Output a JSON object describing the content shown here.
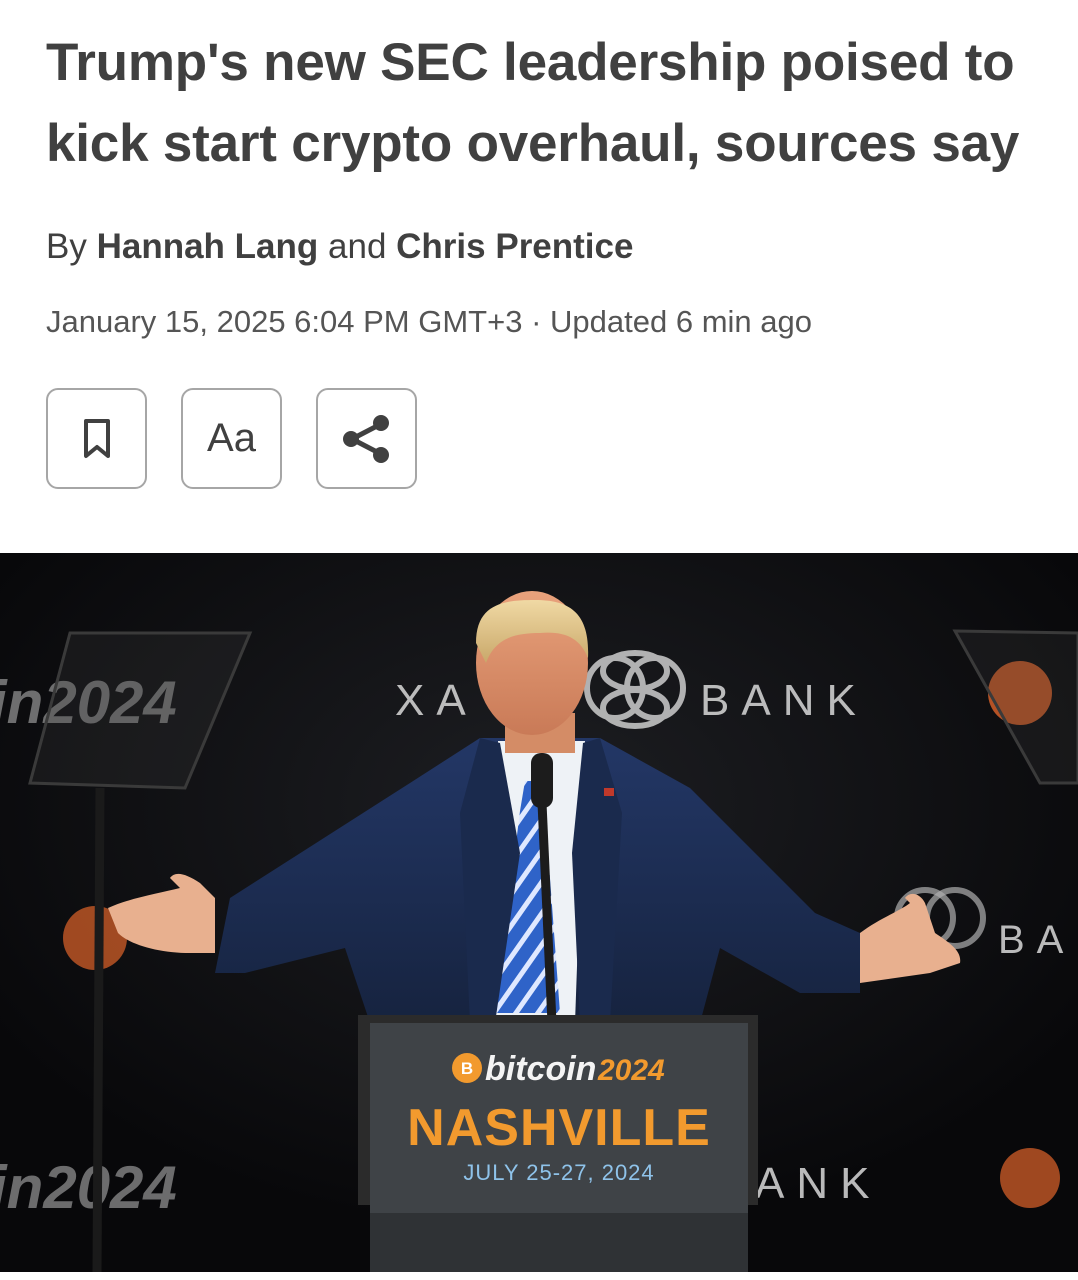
{
  "article": {
    "headline": "Trump's new SEC leadership poised to kick start crypto overhaul, sources say",
    "byline": {
      "prefix": "By",
      "author_1": "Hannah Lang",
      "connector": "and",
      "author_2": "Chris Prentice"
    },
    "date": "January 15, 2025 6:04 PM GMT+3",
    "separator": "·",
    "updated": "Updated 6 min ago"
  },
  "toolbar": {
    "bookmark_icon": "bookmark-icon",
    "text_size_label": "Aa",
    "share_icon": "share-icon"
  },
  "photo": {
    "backdrop_left_top": "in2024",
    "backdrop_center": "XA",
    "backdrop_bank": "BANK",
    "backdrop_right_mid": "BA",
    "backdrop_left_bottom": "in2024",
    "backdrop_bank_bottom": "ANK",
    "podium": {
      "brand_a": "bitcoin",
      "brand_b": "2024",
      "city": "NASHVILLE",
      "dates": "JULY 25-27, 2024"
    }
  },
  "colors": {
    "text": "#404040",
    "orange": "#f29a2e",
    "suit": "#1b2b52",
    "background": "#0d0d0e"
  }
}
